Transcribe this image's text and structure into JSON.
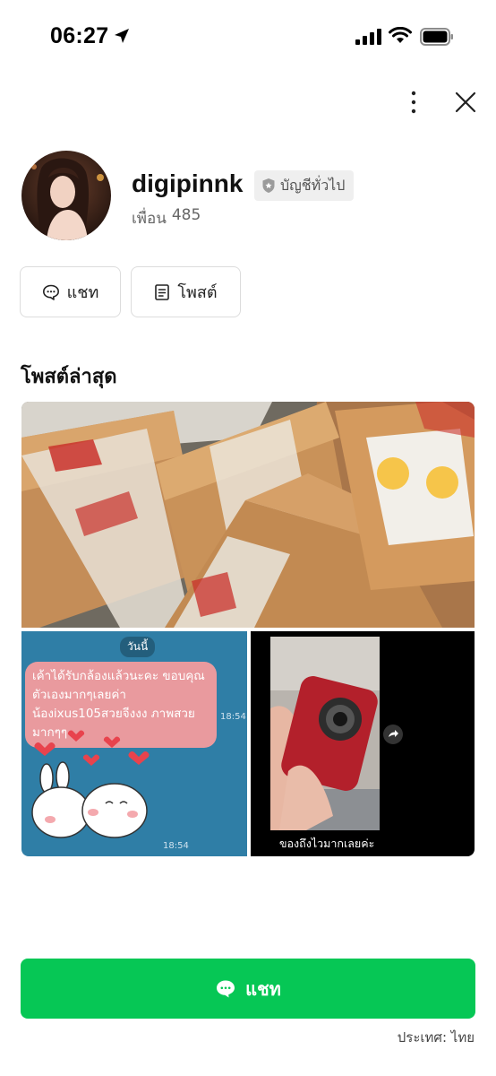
{
  "status_bar": {
    "time": "06:27",
    "location_icon": "location-arrow-icon",
    "signal_icon": "cellular-signal-icon",
    "wifi_icon": "wifi-icon",
    "battery_icon": "battery-full-icon"
  },
  "top_actions": {
    "more_icon": "more-vertical-icon",
    "close_icon": "close-icon"
  },
  "profile": {
    "name": "digipinnk",
    "badge_label": "บัญชีทั่วไป",
    "friends_label": "เพื่อน",
    "friends_count": "485"
  },
  "actions": {
    "chat_label": "แชท",
    "post_label": "โพสต์"
  },
  "latest_posts": {
    "title": "โพสต์ล่าสุด",
    "chat_post": {
      "date_label": "วันนี้",
      "message": "เค้าได้รับกล้องแล้วนะคะ ขอบคุณตัวเองมากๆเลยค่า น้องixus105สวยจีงงง ภาพสวยมากๆๆ",
      "time1": "18:54",
      "time2": "18:54"
    },
    "camera_post": {
      "caption": "ของถึงไวมากเลยค่ะ"
    }
  },
  "bottom": {
    "chat_button_label": "แชท",
    "country": "ประเทศ: ไทย"
  },
  "colors": {
    "line_green": "#06c755",
    "chat_bg": "#2f7ea6",
    "bubble_pink": "#e99a9e"
  }
}
